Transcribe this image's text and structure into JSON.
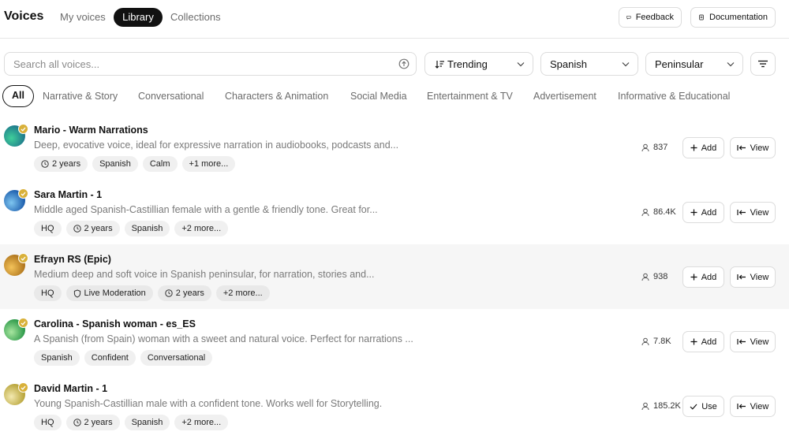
{
  "header": {
    "title": "Voices",
    "tabs": [
      {
        "label": "My voices"
      },
      {
        "label": "Library"
      },
      {
        "label": "Collections"
      }
    ],
    "feedback_label": "Feedback",
    "documentation_label": "Documentation"
  },
  "search": {
    "placeholder": "Search all voices..."
  },
  "filters": {
    "sort_label": "Trending",
    "language_label": "Spanish",
    "accent_label": "Peninsular"
  },
  "categories": [
    {
      "label": "All"
    },
    {
      "label": "Narrative & Story"
    },
    {
      "label": "Conversational"
    },
    {
      "label": "Characters & Animation"
    },
    {
      "label": "Social Media"
    },
    {
      "label": "Entertainment & TV"
    },
    {
      "label": "Advertisement"
    },
    {
      "label": "Informative & Educational"
    }
  ],
  "voices": [
    {
      "name": "Mario - Warm Narrations",
      "description": "Deep, evocative voice, ideal for expressive narration in audiobooks, podcasts and...",
      "tags": [
        "2 years",
        "Spanish",
        "Calm",
        "+1 more..."
      ],
      "count": "837",
      "primary_action": "Add",
      "view_label": "View",
      "avatar_colors": [
        "#1f7a8c",
        "#3fcf9a"
      ]
    },
    {
      "name": "Sara Martin - 1",
      "description": "Middle aged Spanish-Castillian female with a gentle & friendly tone. Great for...",
      "tags": [
        "HQ",
        "2 years",
        "Spanish",
        "+2 more..."
      ],
      "count": "86.4K",
      "primary_action": "Add",
      "view_label": "View",
      "avatar_colors": [
        "#1e5fae",
        "#7fc6f0"
      ]
    },
    {
      "name": "Efrayn RS (Epic)",
      "description": "Medium deep and soft voice in Spanish peninsular, for narration, stories and...",
      "tags": [
        "HQ",
        "Live Moderation",
        "2 years",
        "+2 more..."
      ],
      "count": "938",
      "primary_action": "Add",
      "view_label": "View",
      "avatar_colors": [
        "#b0761e",
        "#f4c35a"
      ]
    },
    {
      "name": "Carolina - Spanish woman - es_ES",
      "description": "A Spanish (from Spain) woman with a sweet and natural voice. Perfect for narrations ...",
      "tags": [
        "Spanish",
        "Confident",
        "Conversational"
      ],
      "count": "7.8K",
      "primary_action": "Add",
      "view_label": "View",
      "avatar_colors": [
        "#2e9a4a",
        "#a8e6a0"
      ]
    },
    {
      "name": "David Martin - 1",
      "description": "Young Spanish-Castillian male with a confident tone. Works well for Storytelling.",
      "tags": [
        "HQ",
        "2 years",
        "Spanish",
        "+2 more..."
      ],
      "count": "185.2K",
      "primary_action": "Use",
      "view_label": "View",
      "avatar_colors": [
        "#b8a43a",
        "#f3e9b0"
      ]
    }
  ]
}
